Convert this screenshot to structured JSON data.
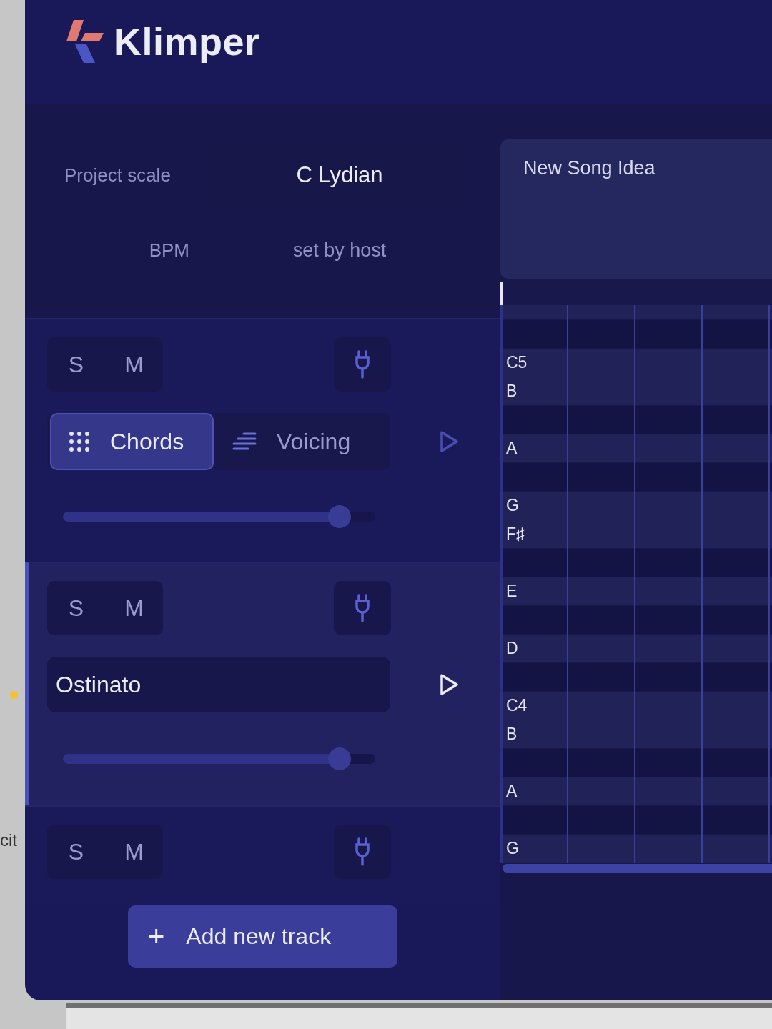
{
  "host": {
    "label": "cit"
  },
  "app": {
    "title": "Klimper"
  },
  "settings": [
    {
      "label": "Project scale",
      "value": "C Lydian",
      "kind": "select"
    },
    {
      "label": "BPM",
      "value": "set by host",
      "kind": "text"
    }
  ],
  "note": {
    "value": "New Song Idea"
  },
  "tracks": [
    {
      "kind": "modes",
      "selected": false,
      "solo": "S",
      "mute": "M",
      "modes": [
        {
          "label": "Chords",
          "selected": true
        },
        {
          "label": "Voicing",
          "selected": false
        }
      ],
      "level": 0.886
    },
    {
      "kind": "named",
      "selected": true,
      "solo": "S",
      "mute": "M",
      "name": "Ostinato",
      "level": 0.886
    },
    {
      "kind": "collapsed",
      "selected": false,
      "solo": "S",
      "mute": "M"
    }
  ],
  "add_button": {
    "icon": "+",
    "label": "Add new track"
  },
  "piano_roll": {
    "rows": [
      {
        "kind": "white"
      },
      {
        "kind": "black"
      },
      {
        "kind": "white",
        "label": "C5"
      },
      {
        "kind": "white",
        "label": "B"
      },
      {
        "kind": "black"
      },
      {
        "kind": "white",
        "label": "A"
      },
      {
        "kind": "black"
      },
      {
        "kind": "white",
        "label": "G"
      },
      {
        "kind": "white",
        "label": "F♯"
      },
      {
        "kind": "black"
      },
      {
        "kind": "white",
        "label": "E"
      },
      {
        "kind": "black"
      },
      {
        "kind": "white",
        "label": "D"
      },
      {
        "kind": "black"
      },
      {
        "kind": "white",
        "label": "C4"
      },
      {
        "kind": "white",
        "label": "B"
      },
      {
        "kind": "black"
      },
      {
        "kind": "white",
        "label": "A"
      },
      {
        "kind": "black"
      },
      {
        "kind": "white",
        "label": "G"
      }
    ]
  }
}
